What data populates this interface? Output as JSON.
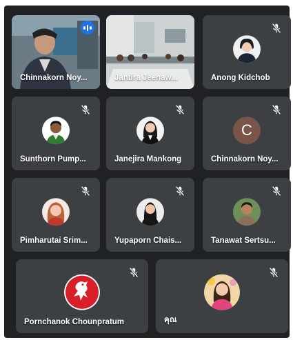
{
  "meeting": {
    "participants": [
      {
        "name": "Chinnakorn Noy...",
        "state": "speaking",
        "media": "camera"
      },
      {
        "name": "Jantira Jeenaw...",
        "state": "video",
        "media": "camera"
      },
      {
        "name": "Anong Kidchob",
        "state": "muted",
        "media": "photo"
      },
      {
        "name": "Sunthorn Pump...",
        "state": "muted",
        "media": "photo"
      },
      {
        "name": "Janejira Mankong",
        "state": "muted",
        "media": "photo"
      },
      {
        "name": "Chinnakorn Noy...",
        "state": "muted",
        "media": "letter",
        "initial": "C"
      },
      {
        "name": "Pimharutai Srim...",
        "state": "muted",
        "media": "photo"
      },
      {
        "name": "Yupaporn Chais...",
        "state": "muted",
        "media": "photo"
      },
      {
        "name": "Tanawat Sertsu...",
        "state": "muted",
        "media": "photo"
      },
      {
        "name": "Pornchanok Chounpratum",
        "state": "muted",
        "media": "logo"
      },
      {
        "name": "คุณ",
        "state": "muted",
        "media": "photo"
      }
    ]
  },
  "colors": {
    "background": "#202124",
    "tile": "#3c4043",
    "speaking_outline": "#8ab4f8",
    "speaker_badge": "#1a73e8",
    "letter_avatar": "#795548"
  },
  "icons": {
    "muted": "mic-off-icon",
    "speaking": "audio-level-icon"
  }
}
